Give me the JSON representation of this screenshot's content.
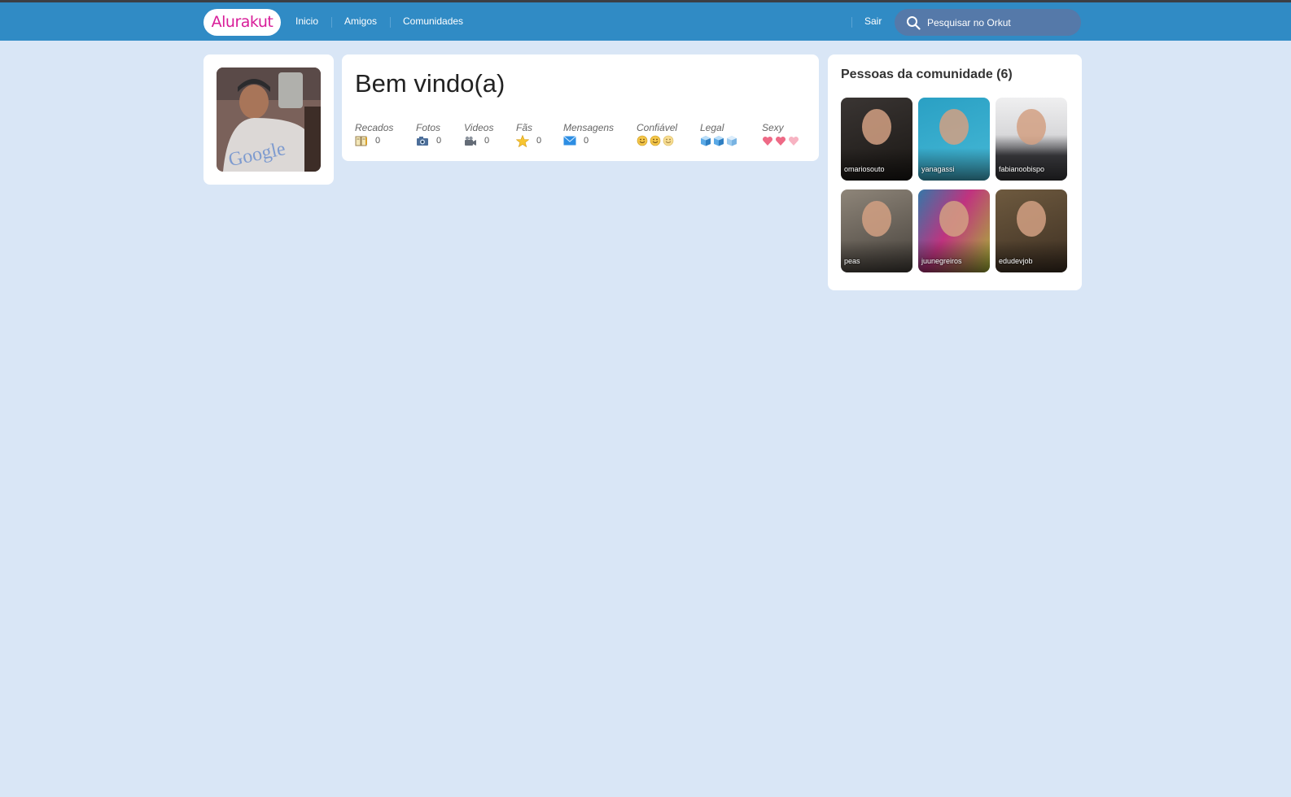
{
  "header": {
    "logo": "Alurakut",
    "nav": [
      "Inicio",
      "Amigos",
      "Comunidades"
    ],
    "logout": "Sair",
    "search_placeholder": "Pesquisar no Orkut"
  },
  "welcome": {
    "title": "Bem vindo(a)",
    "stats": [
      {
        "label": "Recados",
        "icon": "book-icon",
        "value": "0"
      },
      {
        "label": "Fotos",
        "icon": "camera-icon",
        "value": "0"
      },
      {
        "label": "Videos",
        "icon": "video-camera-icon",
        "value": "0"
      },
      {
        "label": "Fãs",
        "icon": "star-icon",
        "value": "0"
      },
      {
        "label": "Mensagens",
        "icon": "envelope-icon",
        "value": "0"
      }
    ],
    "ratings": [
      {
        "label": "Confiável",
        "icon": "smiley-icon",
        "count": 3
      },
      {
        "label": "Legal",
        "icon": "ice-cube-icon",
        "count": 3
      },
      {
        "label": "Sexy",
        "icon": "heart-icon",
        "count": 3
      }
    ]
  },
  "community": {
    "title": "Pessoas da comunidade (6)",
    "people": [
      {
        "name": "omariosouto",
        "bg": "#3a3533",
        "bg2": "#1a1714"
      },
      {
        "name": "yanagassi",
        "bg": "#2aa0c4",
        "bg2": "#1c8fb8"
      },
      {
        "name": "fabianoobispo",
        "bg": "#efeff0",
        "bg2": "#3a3a3e"
      },
      {
        "name": "peas",
        "bg": "#8e8579",
        "bg2": "#46413b"
      },
      {
        "name": "juunegreiros",
        "bg": "#3577a8",
        "bg2": "#a6b833"
      },
      {
        "name": "edudevjob",
        "bg": "#6e5a3f",
        "bg2": "#3d2f22"
      }
    ]
  },
  "colors": {
    "header": "#308bc5",
    "background": "#d9e6f6",
    "logo_text": "#d81d99"
  }
}
